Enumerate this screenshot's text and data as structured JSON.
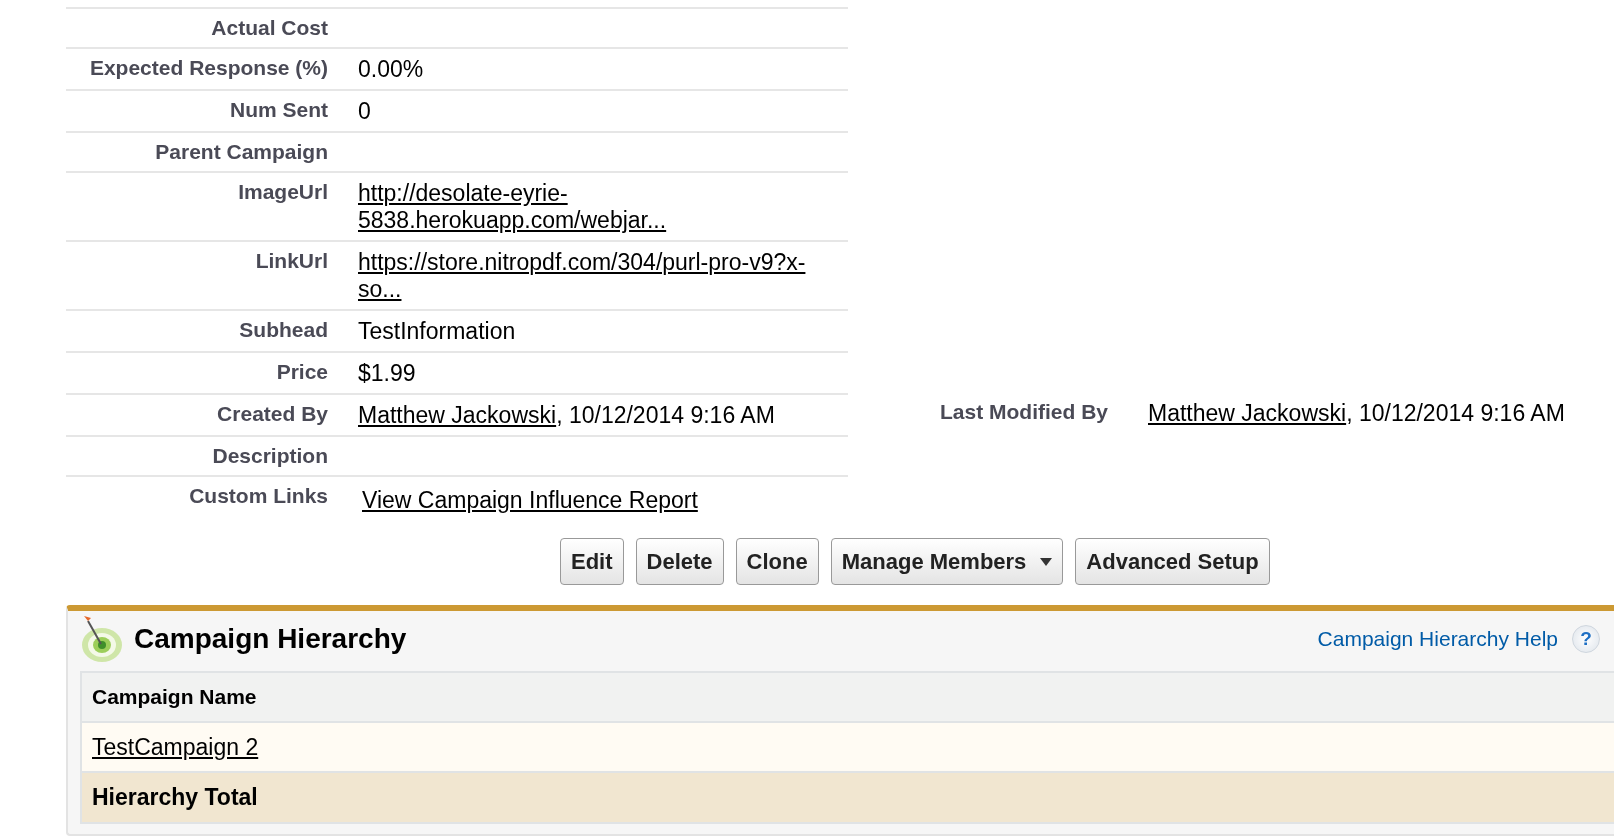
{
  "details": [
    {
      "label": "Actual Cost",
      "kind": "text"
    },
    {
      "label": "Expected Response (%)",
      "kind": "text",
      "value": "0.00%"
    },
    {
      "label": "Num Sent",
      "kind": "text",
      "value": "0"
    },
    {
      "label": "Parent Campaign",
      "kind": "text"
    },
    {
      "label": "ImageUrl",
      "kind": "link",
      "value": "http://desolate-eyrie-5838.herokuapp.com/webjar..."
    },
    {
      "label": "LinkUrl",
      "kind": "link",
      "value": "https://store.nitropdf.com/304/purl-pro-v9?x-so..."
    },
    {
      "label": "Subhead",
      "kind": "text",
      "value": "TestInformation"
    },
    {
      "label": "Price",
      "kind": "text",
      "value": "$1.99"
    },
    {
      "label": "Created By",
      "kind": "user",
      "user": "Matthew Jackowski",
      "value": ", 10/12/2014 9:16 AM",
      "right": {
        "label": "Last Modified By",
        "user": "Matthew Jackowski",
        "value": ", 10/12/2014 9:16 AM"
      }
    },
    {
      "label": "Description",
      "kind": "text"
    },
    {
      "label": "Custom Links",
      "kind": "custom",
      "value": "View Campaign Influence Report"
    }
  ],
  "buttons": [
    {
      "label": "Edit",
      "dropdown": false
    },
    {
      "label": "Delete",
      "dropdown": false
    },
    {
      "label": "Clone",
      "dropdown": false
    },
    {
      "label": "Manage Members",
      "dropdown": true
    },
    {
      "label": "Advanced Setup",
      "dropdown": false
    }
  ],
  "hierarchy": {
    "title": "Campaign Hierarchy",
    "help_link": "Campaign Hierarchy Help",
    "help_icon": "?",
    "columns": [
      "Campaign Name"
    ],
    "rows": [
      {
        "kind": "item",
        "cells": [
          "TestCampaign 2"
        ]
      },
      {
        "kind": "total",
        "cells": [
          "Hierarchy Total"
        ]
      }
    ]
  }
}
